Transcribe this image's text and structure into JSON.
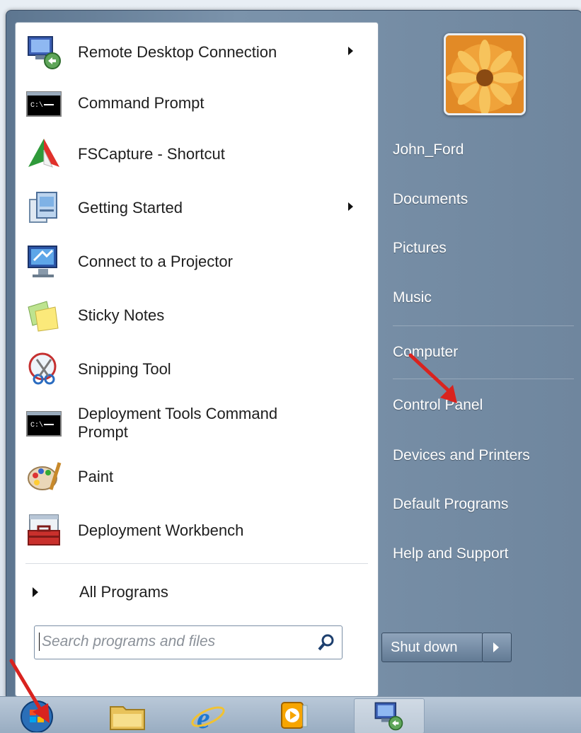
{
  "start_menu": {
    "programs": [
      {
        "label": "Remote Desktop Connection",
        "has_submenu": true,
        "icon": "remote-desktop-icon"
      },
      {
        "label": "Command Prompt",
        "has_submenu": false,
        "icon": "command-prompt-icon"
      },
      {
        "label": "FSCapture - Shortcut",
        "has_submenu": false,
        "icon": "fscapture-icon"
      },
      {
        "label": "Getting Started",
        "has_submenu": true,
        "icon": "getting-started-icon"
      },
      {
        "label": "Connect to a Projector",
        "has_submenu": false,
        "icon": "projector-icon"
      },
      {
        "label": "Sticky Notes",
        "has_submenu": false,
        "icon": "sticky-notes-icon"
      },
      {
        "label": "Snipping Tool",
        "has_submenu": false,
        "icon": "snipping-tool-icon"
      },
      {
        "label": "Deployment Tools Command Prompt",
        "has_submenu": false,
        "icon": "command-prompt-icon"
      },
      {
        "label": "Paint",
        "has_submenu": false,
        "icon": "paint-icon"
      },
      {
        "label": "Deployment Workbench",
        "has_submenu": false,
        "icon": "toolbox-icon"
      }
    ],
    "all_programs": "All Programs",
    "search": {
      "placeholder": "Search programs and files"
    },
    "right_links": [
      {
        "label": "John_Ford"
      },
      {
        "label": "Documents"
      },
      {
        "label": "Pictures"
      },
      {
        "label": "Music"
      },
      {
        "label": "Computer"
      },
      {
        "label": "Control Panel"
      },
      {
        "label": "Devices and Printers"
      },
      {
        "label": "Default Programs"
      },
      {
        "label": "Help and Support"
      }
    ],
    "shutdown": {
      "label": "Shut down"
    }
  },
  "taskbar": {
    "items": [
      {
        "icon": "start-orb-icon"
      },
      {
        "icon": "windows-explorer-icon"
      },
      {
        "icon": "internet-explorer-icon"
      },
      {
        "icon": "media-player-icon"
      },
      {
        "icon": "remote-desktop-icon"
      }
    ]
  },
  "colors": {
    "menu_right": "#6f869e",
    "accent": "#d9231f",
    "text": "#1e1e1e"
  }
}
